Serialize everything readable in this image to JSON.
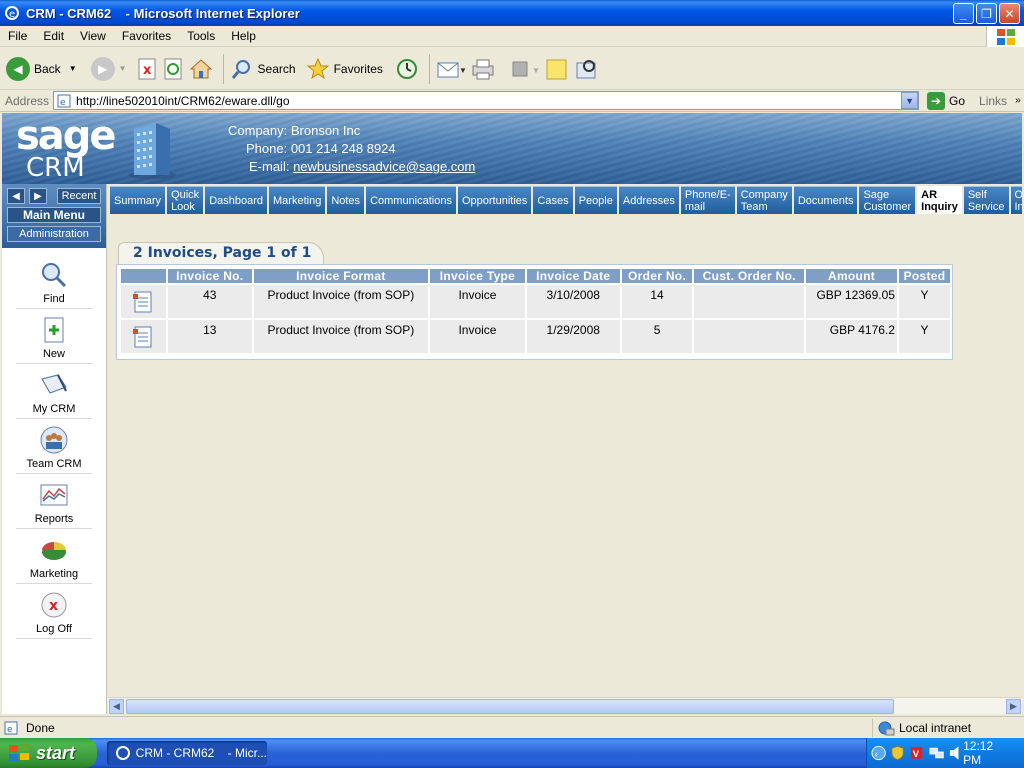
{
  "window": {
    "title": "CRM - CRM62    - Microsoft Internet Explorer"
  },
  "menu": [
    "File",
    "Edit",
    "View",
    "Favorites",
    "Tools",
    "Help"
  ],
  "toolbar": {
    "back": "Back",
    "search": "Search",
    "favorites": "Favorites"
  },
  "address": {
    "label": "Address",
    "url": "http://line502010int/CRM62/eware.dll/go",
    "go": "Go",
    "links": "Links"
  },
  "header": {
    "logo_top": "sage",
    "logo_bottom": "CRM",
    "company": "Company: Bronson Inc",
    "phone": "Phone: 001 214 248 8924",
    "email_label": "E-mail: ",
    "email": "newbusinessadvice@sage.com"
  },
  "leftnav": {
    "recent": "Recent",
    "main_menu": "Main Menu",
    "administration": "Administration",
    "items": [
      "Find",
      "New",
      "My CRM",
      "Team CRM",
      "Reports",
      "Marketing",
      "Log Off"
    ]
  },
  "tabs": [
    {
      "label": "Summary",
      "active": false
    },
    {
      "label": "Quick\nLook",
      "active": false
    },
    {
      "label": "Dashboard",
      "active": false
    },
    {
      "label": "Marketing",
      "active": false
    },
    {
      "label": "Notes",
      "active": false
    },
    {
      "label": "Communications",
      "active": false
    },
    {
      "label": "Opportunities",
      "active": false
    },
    {
      "label": "Cases",
      "active": false
    },
    {
      "label": "People",
      "active": false
    },
    {
      "label": "Addresses",
      "active": false
    },
    {
      "label": "Phone/E-\nmail",
      "active": false
    },
    {
      "label": "Company\nTeam",
      "active": false
    },
    {
      "label": "Documents",
      "active": false
    },
    {
      "label": "Sage\nCustomer",
      "active": false
    },
    {
      "label": "AR\nInquiry",
      "active": true
    },
    {
      "label": "Self\nService",
      "active": false
    },
    {
      "label": "O\nIn",
      "active": false
    }
  ],
  "panel": {
    "title": "2 Invoices, Page 1 of 1",
    "columns": [
      "Invoice No.",
      "Invoice Format",
      "Invoice Type",
      "Invoice Date",
      "Order No.",
      "Cust. Order No.",
      "Amount",
      "Posted"
    ],
    "rows": [
      [
        "43",
        "Product Invoice (from SOP)",
        "Invoice",
        "3/10/2008",
        "14",
        "",
        "GBP 12369.05",
        "Y"
      ],
      [
        "13",
        "Product Invoice (from SOP)",
        "Invoice",
        "1/29/2008",
        "5",
        "",
        "GBP 4176.2",
        "Y"
      ]
    ]
  },
  "status": {
    "text": "Done",
    "zone": "Local intranet"
  },
  "taskbar": {
    "start": "start",
    "item": "CRM - CRM62    - Micr...",
    "clock": "12:12 PM"
  },
  "colors": {
    "title_blue": "#0058e6",
    "header_blue": "#4f82b8",
    "tab_blue": "#1f5d9f",
    "table_header": "#7f9fc7",
    "panel_title": "#1c4c8c"
  }
}
